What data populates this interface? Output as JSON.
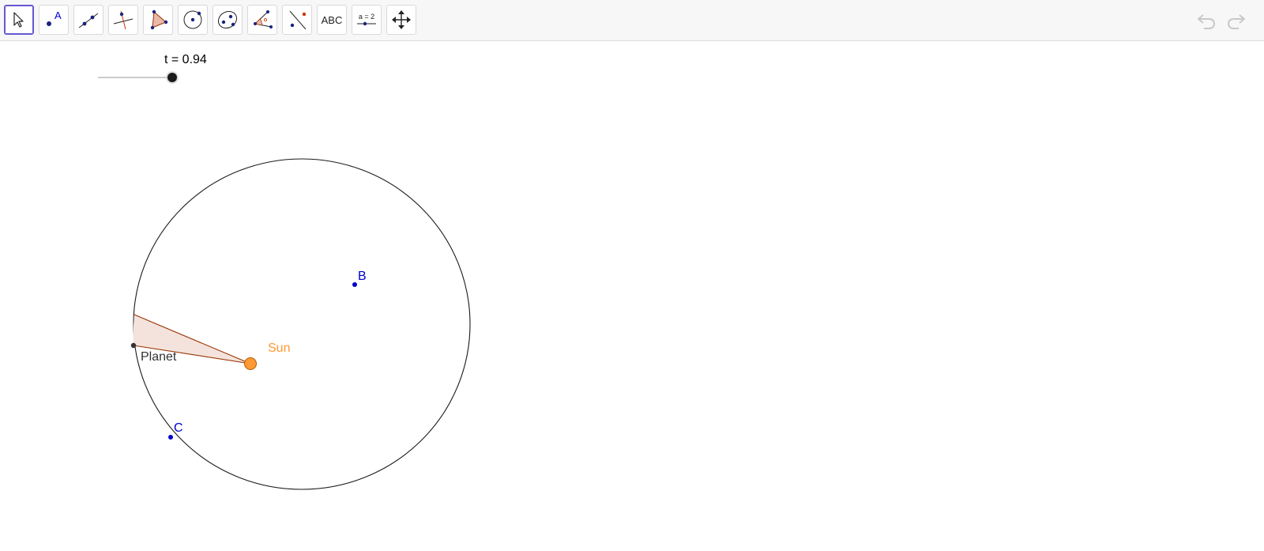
{
  "toolbar": {
    "tools": [
      {
        "name": "move-tool",
        "icon": "cursor-arrow-icon",
        "active": true
      },
      {
        "name": "point-tool",
        "icon": "point-icon",
        "label": "A"
      },
      {
        "name": "line-tool",
        "icon": "line-through-points-icon"
      },
      {
        "name": "perpendicular-line-tool",
        "icon": "perpendicular-line-icon"
      },
      {
        "name": "polygon-tool",
        "icon": "polygon-icon"
      },
      {
        "name": "circle-tool",
        "icon": "circle-center-point-icon"
      },
      {
        "name": "conic-tool",
        "icon": "ellipse-icon"
      },
      {
        "name": "angle-tool",
        "icon": "angle-icon"
      },
      {
        "name": "reflect-tool",
        "icon": "reflect-about-line-icon"
      },
      {
        "name": "text-tool",
        "icon": "text-icon",
        "label": "ABC"
      },
      {
        "name": "slider-tool",
        "icon": "slider-icon",
        "label": "a = 2"
      },
      {
        "name": "move-graphics-view-tool",
        "icon": "move-arrows-icon"
      }
    ],
    "undo_icon": "undo-icon",
    "redo_icon": "redo-icon"
  },
  "slider": {
    "label": "t = 0.94",
    "value": 0.94
  },
  "construction": {
    "point_b_label": "B",
    "point_c_label": "C",
    "sun_label": "Sun",
    "planet_label": "Planet"
  },
  "colors": {
    "accent": "#6557d2",
    "point_blue": "#0000cc",
    "sun_orange": "#ff9933",
    "sector_stroke": "#993300",
    "sector_fill": "#f3e3dc",
    "undo_disabled": "#cfcfcf"
  }
}
